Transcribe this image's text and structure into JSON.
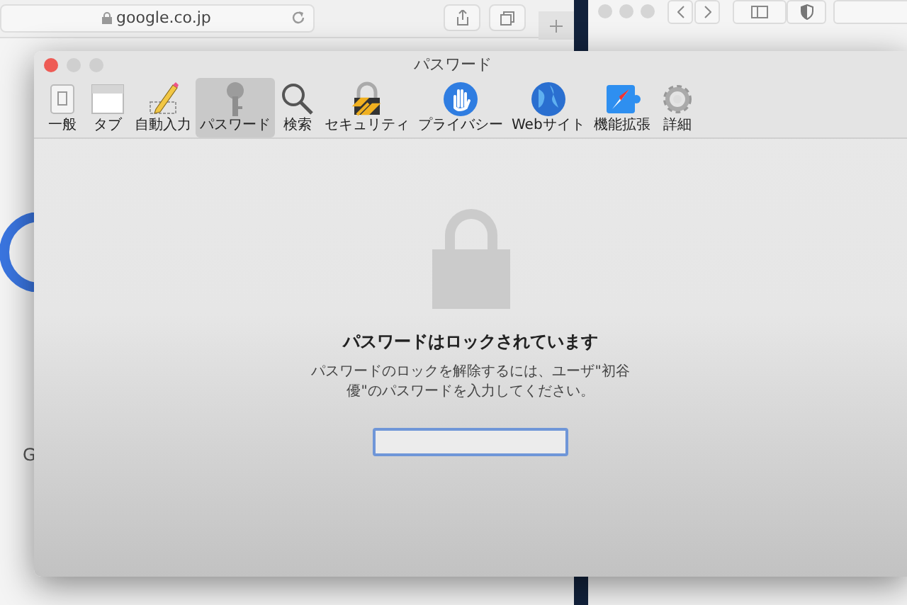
{
  "background_browser": {
    "address": "google.co.jp",
    "page_text": "G"
  },
  "window": {
    "title": "パスワード"
  },
  "toolbar": [
    {
      "label": "一般",
      "selected": false
    },
    {
      "label": "タブ",
      "selected": false
    },
    {
      "label": "自動入力",
      "selected": false
    },
    {
      "label": "パスワード",
      "selected": true
    },
    {
      "label": "検索",
      "selected": false
    },
    {
      "label": "セキュリティ",
      "selected": false
    },
    {
      "label": "プライバシー",
      "selected": false
    },
    {
      "label": "Webサイト",
      "selected": false
    },
    {
      "label": "機能拡張",
      "selected": false
    },
    {
      "label": "詳細",
      "selected": false
    }
  ],
  "locked": {
    "heading": "パスワードはロックされています",
    "message": "パスワードのロックを解除するには、ユーザ\"初谷優\"のパスワードを入力してください。"
  }
}
